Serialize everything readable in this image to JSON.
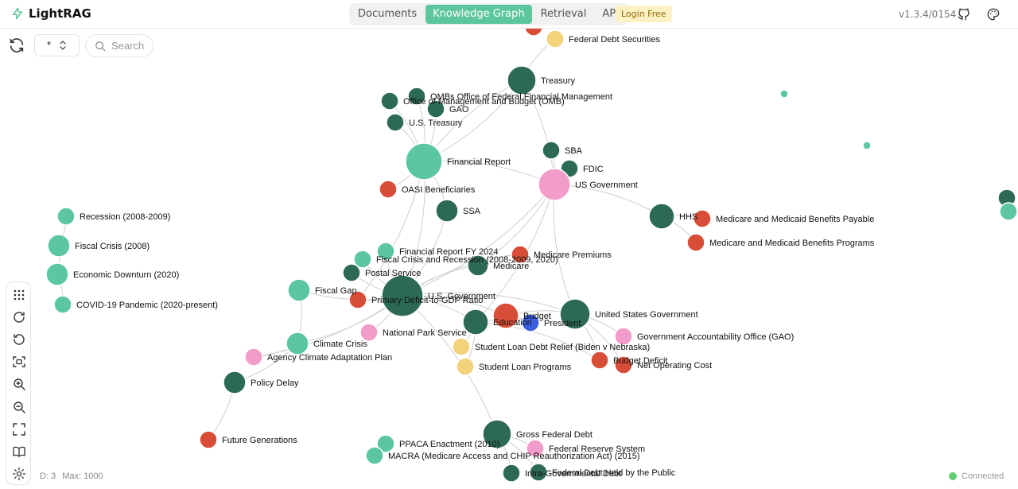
{
  "app": {
    "name": "LightRAG",
    "version": "v1.3.4/0154",
    "login_label": "Login Free"
  },
  "tabs": [
    {
      "label": "Documents",
      "active": false
    },
    {
      "label": "Knowledge Graph",
      "active": true
    },
    {
      "label": "Retrieval",
      "active": false
    },
    {
      "label": "API",
      "active": false
    }
  ],
  "controls": {
    "label_select_value": "*",
    "search_placeholder": "Search"
  },
  "footer": {
    "depth": "D: 3",
    "max": "Max: 1000",
    "status": "Connected"
  },
  "colors": {
    "accent": "#5cc79d",
    "dark_green": "#2d6a55",
    "teal": "#5cc6a4",
    "red": "#d84d38",
    "pink": "#f19cc9",
    "yellow": "#f2d27a",
    "blue": "#3a5ddb"
  },
  "icons": {
    "logo": "zap-icon",
    "github": "github-icon",
    "theme": "palette-icon",
    "refresh": "refresh-icon",
    "search": "search-icon"
  },
  "graph": {
    "nodes": [
      {
        "label": "Federal Debt Securities"
      },
      {
        "label": "Treasury"
      },
      {
        "label": "OMBs Office of Federal Financial Management"
      },
      {
        "label": "Office of Management and Budget (OMB)"
      },
      {
        "label": "GAO"
      },
      {
        "label": "U.S. Treasury"
      },
      {
        "label": "Financial Report"
      },
      {
        "label": "SBA"
      },
      {
        "label": "FDIC"
      },
      {
        "label": "US Government"
      },
      {
        "label": "OASI Beneficiaries"
      },
      {
        "label": "SSA"
      },
      {
        "label": "HHS"
      },
      {
        "label": "Medicare and Medicaid Benefits Payable"
      },
      {
        "label": "Medicare and Medicaid Benefits Programs"
      },
      {
        "label": "Recession (2008-2009)"
      },
      {
        "label": "Fiscal Crisis (2008)"
      },
      {
        "label": "Economic Downturn (2020)"
      },
      {
        "label": "COVID-19 Pandemic (2020-present)"
      },
      {
        "label": "Financial Report FY 2024"
      },
      {
        "label": "Fiscal Crisis and Recession (2008-2009, 2020)"
      },
      {
        "label": "Medicare Premiums"
      },
      {
        "label": "Medicare"
      },
      {
        "label": "Postal Service"
      },
      {
        "label": "U.S. Government"
      },
      {
        "label": "Fiscal Gap"
      },
      {
        "label": "Primary Deficit-to-GDP Ratio"
      },
      {
        "label": "Budget"
      },
      {
        "label": "Education"
      },
      {
        "label": "President"
      },
      {
        "label": "United States Government"
      },
      {
        "label": "National Park Service"
      },
      {
        "label": "Government Accountability Office (GAO)"
      },
      {
        "label": "Student Loan Debt Relief (Biden v Nebraska)"
      },
      {
        "label": "Climate Crisis"
      },
      {
        "label": "Agency Climate Adaptation Plan"
      },
      {
        "label": "Budget Deficit"
      },
      {
        "label": "Net Operating Cost"
      },
      {
        "label": "Student Loan Programs"
      },
      {
        "label": "Policy Delay"
      },
      {
        "label": "Gross Federal Debt"
      },
      {
        "label": "Future Generations"
      },
      {
        "label": "PPACA Enactment (2010)"
      },
      {
        "label": "Federal Reserve System"
      },
      {
        "label": "MACRA (Medicare Access and CHIP Reauthorization Act) (2015)"
      },
      {
        "label": "Intra-Governmental Debt"
      },
      {
        "label": "Federal Debt Held by the Public"
      }
    ]
  }
}
